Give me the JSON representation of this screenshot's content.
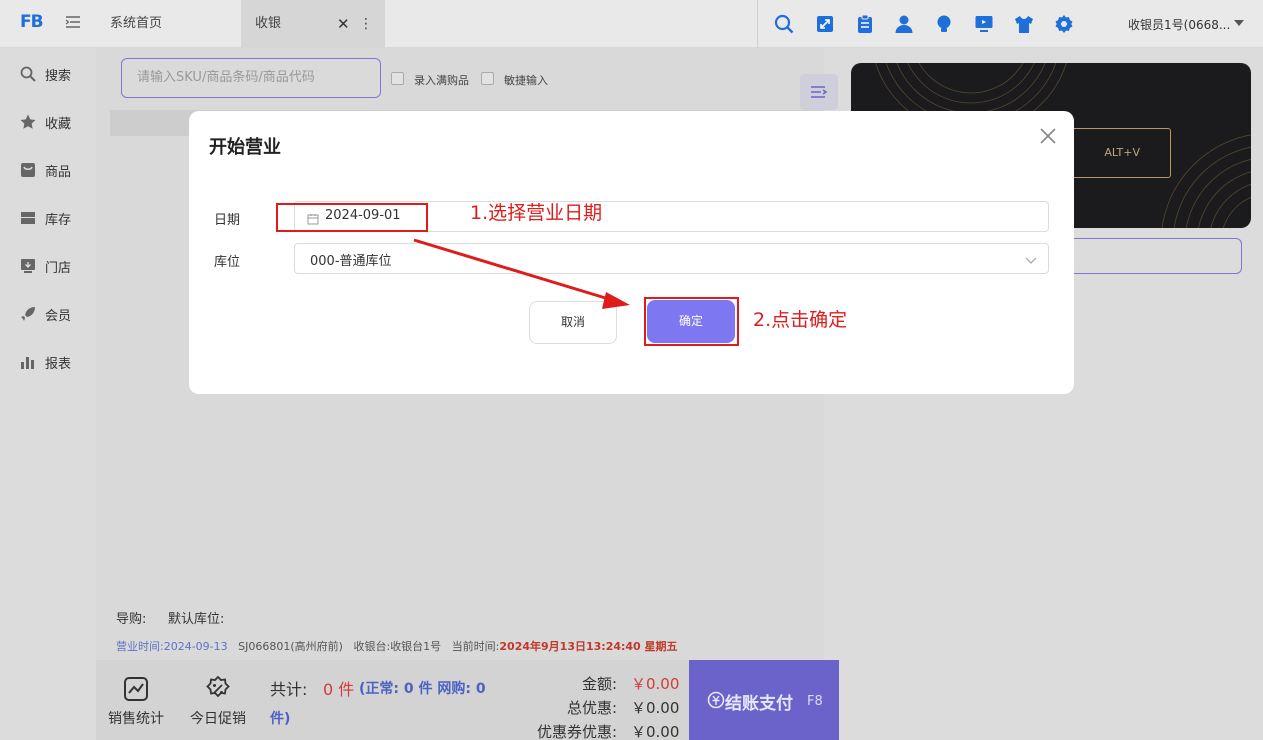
{
  "app": {
    "logo_text": "FB",
    "tabs": [
      {
        "label": "系统首页"
      },
      {
        "label": "收银",
        "close": "✕",
        "more": "⋮"
      }
    ],
    "toolbar_icons": [
      "search-icon",
      "expand-icon",
      "clipboard-icon",
      "user-icon",
      "bulb-icon",
      "monitor-icon",
      "shirt-icon",
      "gear-icon"
    ],
    "user": "收银员1号(0668..."
  },
  "sidebar": {
    "items": [
      {
        "label": "搜索",
        "icon": "search-icon"
      },
      {
        "label": "收藏",
        "icon": "star-icon"
      },
      {
        "label": "商品",
        "icon": "goods-icon"
      },
      {
        "label": "库存",
        "icon": "inventory-icon"
      },
      {
        "label": "门店",
        "icon": "store-icon"
      },
      {
        "label": "会员",
        "icon": "rocket-icon"
      },
      {
        "label": "报表",
        "icon": "chart-icon"
      }
    ]
  },
  "main": {
    "search_placeholder": "请输入SKU/商品条码/商品代码",
    "checkbox_full": "录入满购品",
    "checkbox_quick": "敏捷输入",
    "guide_label": "导购:",
    "default_store_label": "默认库位:",
    "info": {
      "business_time_label": "营业时间:",
      "business_time": "2024-09-13",
      "shop": "SJ066801(高州府前)",
      "register_label": "收银台:",
      "register": "收银台1号",
      "current_time_label": "当前时间:",
      "current_time": "2024年9月13日13:24:40 星期五"
    }
  },
  "bottom": {
    "sales_stats": "销售统计",
    "today_promo": "今日促销",
    "total_label": "共计:",
    "total_count": "0 件",
    "total_detail": "(正常: 0 件  网购: 0",
    "total_detail_end": "件)",
    "amount_label": "金额:",
    "amount_value": "￥0.00",
    "discount_label": "总优惠:",
    "discount_value": "￥0.00",
    "coupon_label": "优惠券优惠:",
    "coupon_value": "￥0.00",
    "checkout_label": "结账支付",
    "checkout_key": "F8"
  },
  "right": {
    "banner_shortcut": "ALT+V"
  },
  "modal": {
    "title": "开始营业",
    "date_label": "日期",
    "date_value": "2024-09-01",
    "store_label": "库位",
    "store_value": "000-普通库位",
    "cancel": "取消",
    "confirm": "确定"
  },
  "annotations": {
    "step1": "1.选择营业日期",
    "step2": "2.点击确定",
    "color": "#e01b1b"
  },
  "colors": {
    "accent": "#7d77f2",
    "checkout": "#6a63c9",
    "brand_blue": "#1e6fd9"
  }
}
